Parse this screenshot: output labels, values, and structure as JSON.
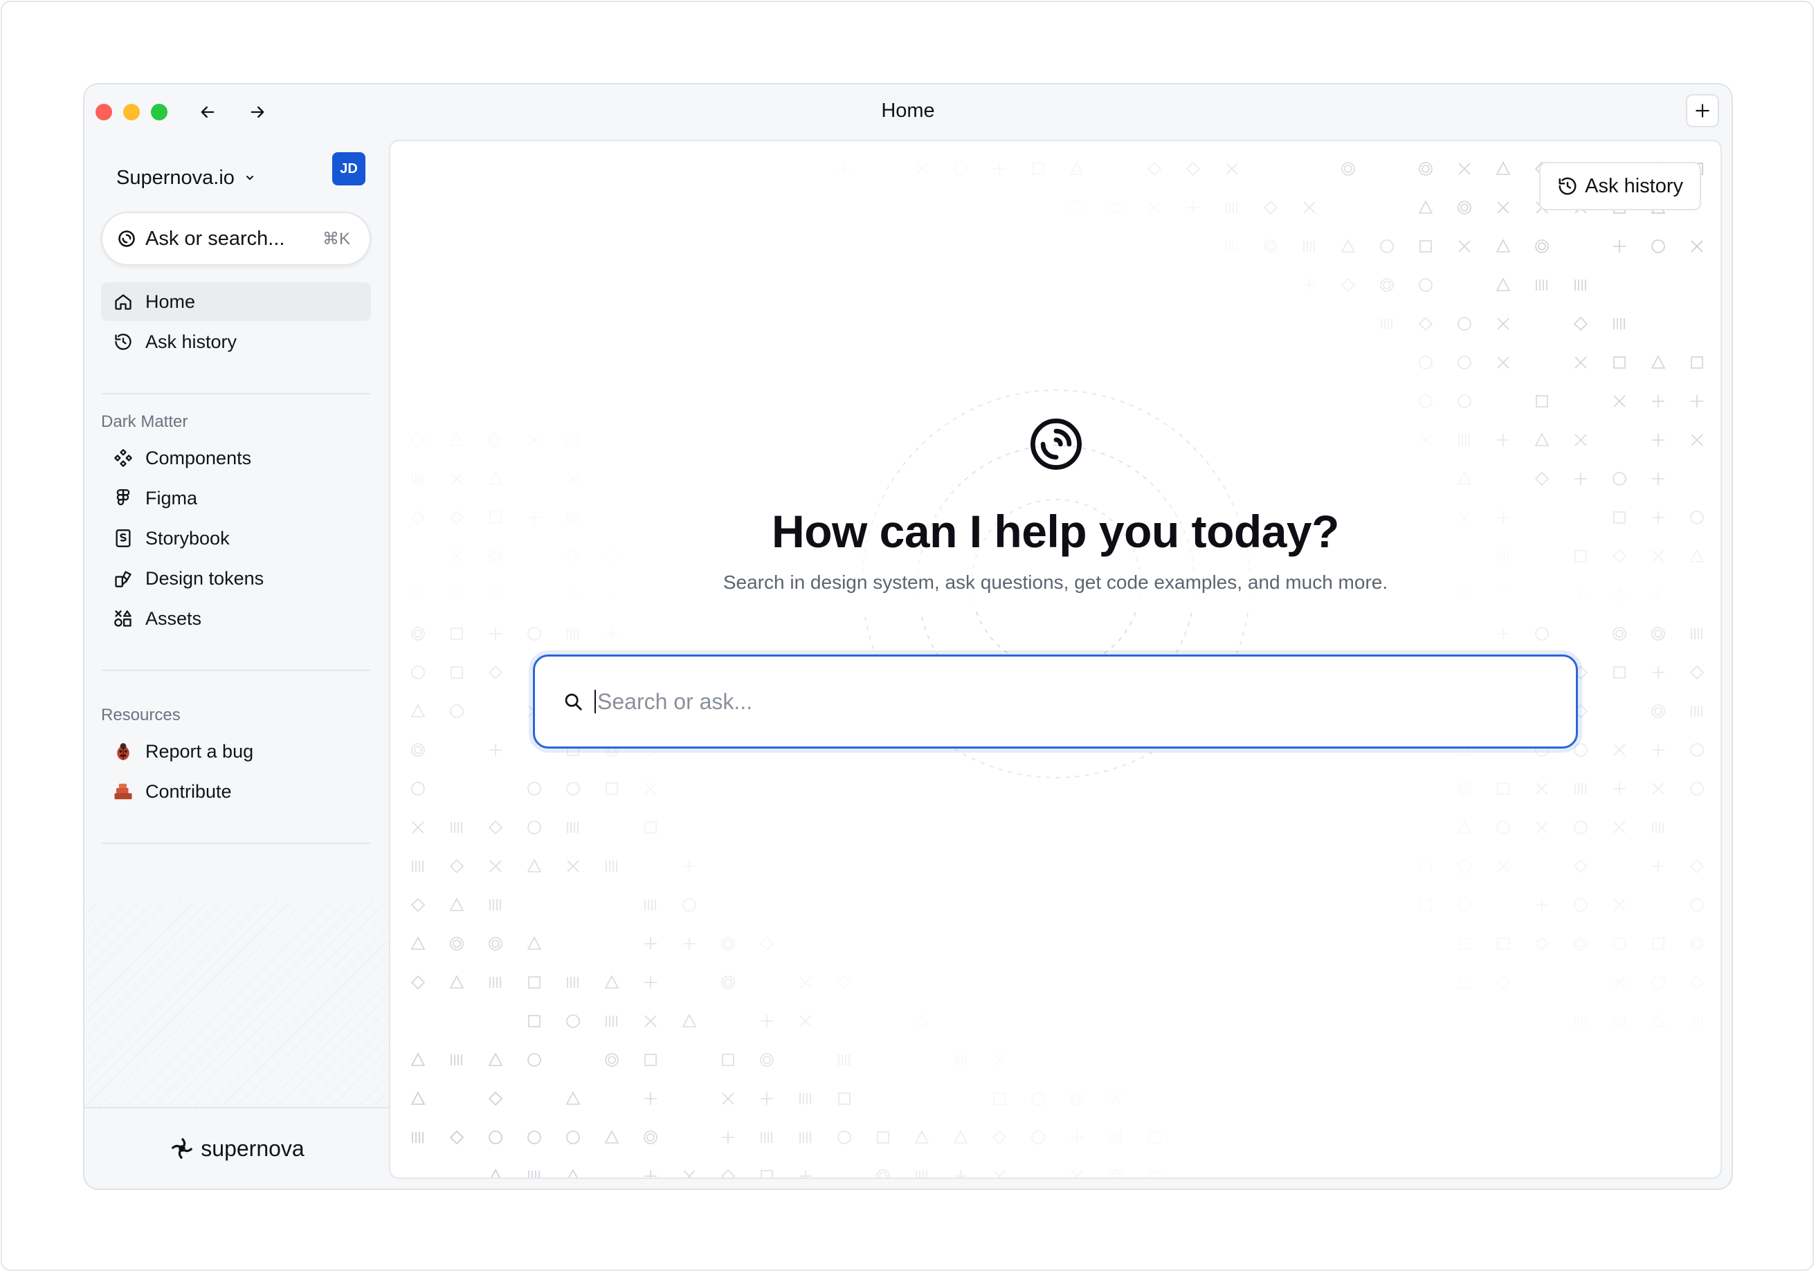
{
  "window": {
    "title": "Home"
  },
  "sidebar": {
    "workspace": "Supernova.io",
    "avatar_initials": "JD",
    "ask_search": {
      "label": "Ask or search...",
      "shortcut": "⌘K"
    },
    "nav": [
      {
        "label": "Home",
        "icon": "home-icon",
        "active": true
      },
      {
        "label": "Ask history",
        "icon": "history-icon",
        "active": false
      }
    ],
    "sections": [
      {
        "title": "Dark Matter",
        "items": [
          {
            "label": "Components",
            "icon": "components-icon"
          },
          {
            "label": "Figma",
            "icon": "figma-icon"
          },
          {
            "label": "Storybook",
            "icon": "storybook-icon"
          },
          {
            "label": "Design tokens",
            "icon": "design-tokens-icon"
          },
          {
            "label": "Assets",
            "icon": "assets-icon"
          }
        ]
      },
      {
        "title": "Resources",
        "items": [
          {
            "label": "Report a bug",
            "icon": "bug-icon"
          },
          {
            "label": "Contribute",
            "icon": "bricks-icon"
          }
        ]
      }
    ],
    "brand": "supernova"
  },
  "main": {
    "ask_history_button": "Ask history",
    "hero_title": "How can I help you today?",
    "hero_subtitle": "Search in design system, ask questions, get code examples, and much more.",
    "search_placeholder": "Search or ask..."
  },
  "colors": {
    "accent": "#2c65d8",
    "avatar_bg": "#1557d4",
    "traffic_red": "#fe5f57",
    "traffic_yellow": "#febc2e",
    "traffic_green": "#28c840"
  }
}
